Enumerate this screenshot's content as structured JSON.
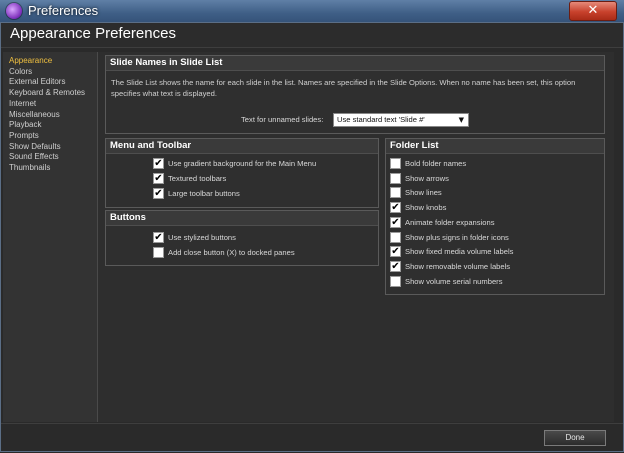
{
  "window": {
    "title": "Preferences",
    "close_glyph": "✕",
    "app_icon": "app-logo-icon"
  },
  "header": {
    "title": "Appearance Preferences"
  },
  "sidebar": {
    "items": [
      {
        "label": "Appearance",
        "active": true
      },
      {
        "label": "Colors"
      },
      {
        "label": "External Editors"
      },
      {
        "label": "Keyboard & Remotes"
      },
      {
        "label": "Internet"
      },
      {
        "label": "Miscellaneous"
      },
      {
        "label": "Playback"
      },
      {
        "label": "Prompts"
      },
      {
        "label": "Show Defaults"
      },
      {
        "label": "Sound Effects"
      },
      {
        "label": "Thumbnails"
      }
    ]
  },
  "slide_names": {
    "title": "Slide Names in Slide List",
    "description": "The Slide List shows the name for each slide in the list. Names are specified in the Slide Options. When no name has been set, this option specifies what text is displayed.",
    "field_label": "Text for unnamed slides:",
    "select_value": "Use standard text 'Slide #'",
    "select_arrow": "▼"
  },
  "menu_toolbar": {
    "title": "Menu and Toolbar",
    "options": [
      {
        "label": "Use gradient background for the Main Menu",
        "checked": true
      },
      {
        "label": "Textured toolbars",
        "checked": true
      },
      {
        "label": "Large toolbar buttons",
        "checked": true
      }
    ]
  },
  "buttons_panel": {
    "title": "Buttons",
    "options": [
      {
        "label": "Use stylized buttons",
        "checked": true
      },
      {
        "label": "Add close button (X) to docked panes",
        "checked": false
      }
    ]
  },
  "folder_list": {
    "title": "Folder List",
    "options": [
      {
        "label": "Bold folder names",
        "checked": false
      },
      {
        "label": "Show arrows",
        "checked": false
      },
      {
        "label": "Show lines",
        "checked": false
      },
      {
        "label": "Show knobs",
        "checked": true
      },
      {
        "label": "Animate folder expansions",
        "checked": true
      },
      {
        "label": "Show plus signs in folder icons",
        "checked": false
      },
      {
        "label": "Show fixed media volume labels",
        "checked": true
      },
      {
        "label": "Show removable volume labels",
        "checked": true
      },
      {
        "label": "Show volume serial numbers",
        "checked": false
      }
    ]
  },
  "footer": {
    "done_label": "Done"
  },
  "check_glyph": "✔"
}
